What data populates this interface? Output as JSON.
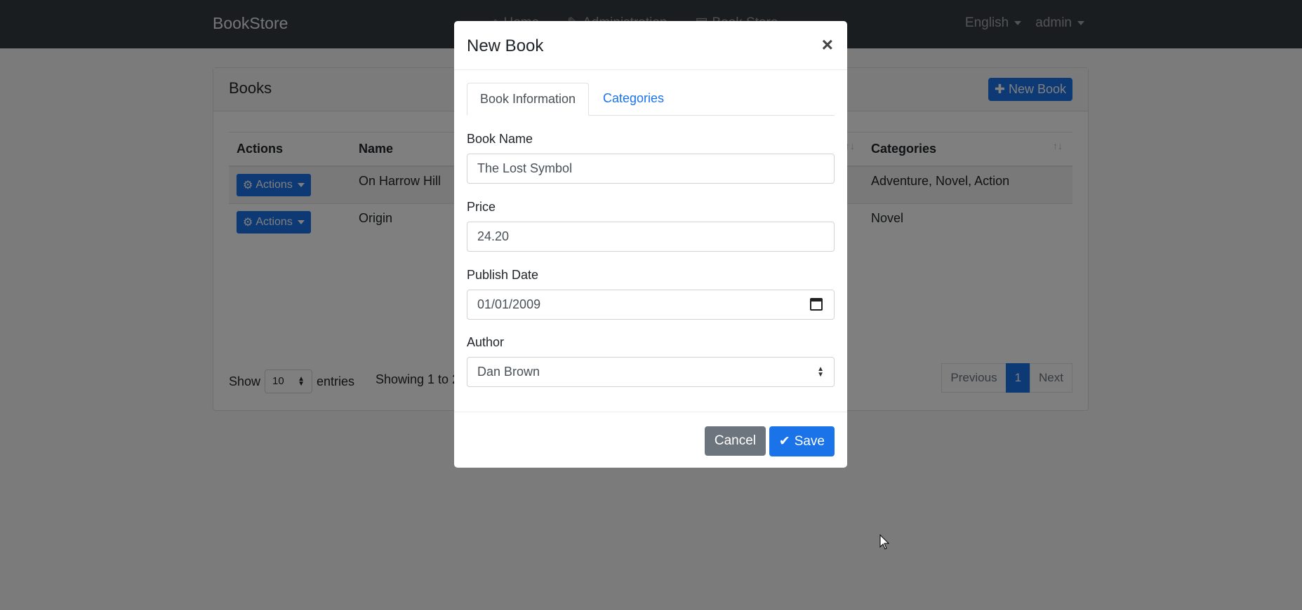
{
  "navbar": {
    "brand": "BookStore",
    "menu": [
      "Home",
      "Administration",
      "Book Store"
    ],
    "language": "English",
    "user": "admin"
  },
  "books_card": {
    "title": "Books",
    "new_button": "New Book",
    "columns": [
      "Actions",
      "Name",
      "Categories"
    ],
    "rows": [
      {
        "action": "Actions",
        "name": "On Harrow Hill",
        "categories": "Adventure, Novel, Action"
      },
      {
        "action": "Actions",
        "name": "Origin",
        "categories": "Novel"
      }
    ],
    "show_label": "Show",
    "entries_value": "10",
    "entries_label": "entries",
    "showing_text": "Showing 1 to 2",
    "pager": {
      "previous": "Previous",
      "page": "1",
      "next": "Next"
    }
  },
  "modal": {
    "title": "New Book",
    "close": "×",
    "tabs": [
      "Book Information",
      "Categories"
    ],
    "fields": {
      "name_label": "Book Name",
      "name_value": "The Lost Symbol",
      "price_label": "Price",
      "price_value": "24.20",
      "date_label": "Publish Date",
      "date_value": "01/01/2009",
      "author_label": "Author",
      "author_value": "Dan Brown"
    },
    "cancel": "Cancel",
    "save": "Save"
  },
  "colors": {
    "primary": "#1a73e8",
    "navbar": "#343a40",
    "secondary": "#6c757d"
  }
}
